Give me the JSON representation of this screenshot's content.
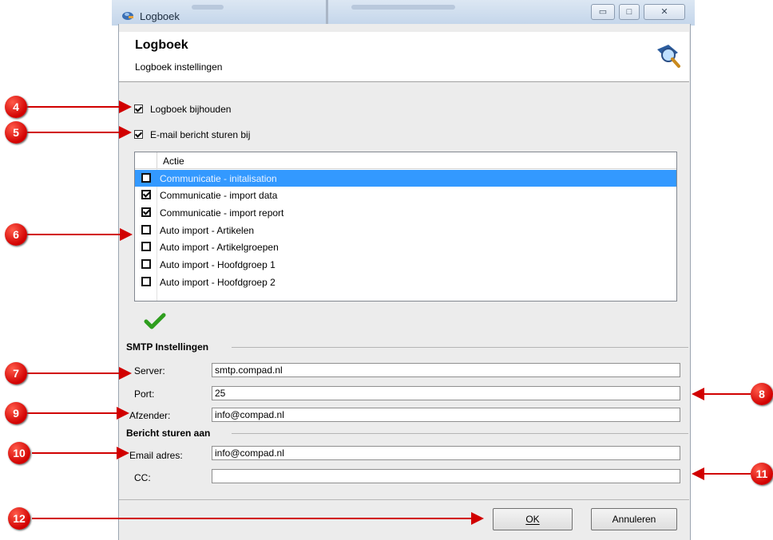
{
  "window": {
    "title": "Logboek",
    "buttons": {
      "minimize": "▭",
      "maximize": "□",
      "close": "✕"
    }
  },
  "header": {
    "title": "Logboek",
    "subtitle": "Logboek instellingen"
  },
  "options": {
    "keep_log": {
      "label": "Logboek bijhouden",
      "checked": true
    },
    "send_email": {
      "label": "E-mail bericht sturen bij",
      "checked": true
    }
  },
  "actions_list": {
    "column_header": "Actie",
    "rows": [
      {
        "label": "Communicatie - initalisation",
        "checked": false,
        "selected": true
      },
      {
        "label": "Communicatie - import data",
        "checked": true,
        "selected": false
      },
      {
        "label": "Communicatie - import report",
        "checked": true,
        "selected": false
      },
      {
        "label": "Auto import - Artikelen",
        "checked": false,
        "selected": false
      },
      {
        "label": "Auto import - Artikelgroepen",
        "checked": false,
        "selected": false
      },
      {
        "label": "Auto import - Hoofdgroep 1",
        "checked": false,
        "selected": false
      },
      {
        "label": "Auto import - Hoofdgroep 2",
        "checked": false,
        "selected": false
      }
    ]
  },
  "smtp": {
    "section_title": "SMTP Instellingen",
    "server_label": "Server:",
    "server_value": "smtp.compad.nl",
    "port_label": "Port:",
    "port_value": "25",
    "sender_label": "Afzender:",
    "sender_value": "info@compad.nl"
  },
  "recipient": {
    "section_title": "Bericht sturen aan",
    "email_label": "Email adres:",
    "email_value": "info@compad.nl",
    "cc_label": "CC:",
    "cc_value": ""
  },
  "footer": {
    "ok_label": "OK",
    "cancel_label": "Annuleren"
  },
  "callouts": {
    "labels": [
      "4",
      "5",
      "6",
      "7",
      "8",
      "9",
      "10",
      "11",
      "12"
    ],
    "color": "#d10000"
  },
  "colors": {
    "selection": "#3399ff",
    "check_green": "#2e9e1e"
  }
}
